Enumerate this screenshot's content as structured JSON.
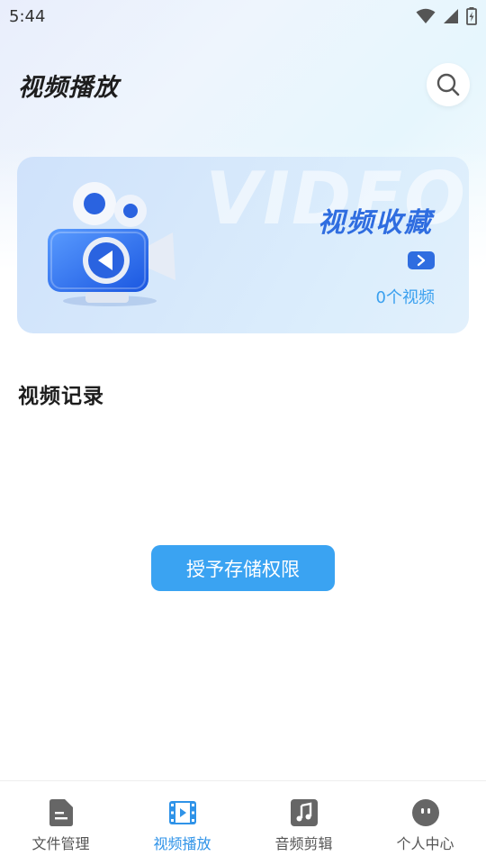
{
  "status_bar": {
    "time": "5:44"
  },
  "header": {
    "title": "视频播放"
  },
  "banner": {
    "watermark": "VIDEO",
    "title": "视频收藏",
    "count_text": "0个视频"
  },
  "section": {
    "title": "视频记录"
  },
  "permission_button": {
    "label": "授予存储权限"
  },
  "tabs": [
    {
      "label": "文件管理",
      "icon": "document-icon",
      "active": false
    },
    {
      "label": "视频播放",
      "icon": "film-icon",
      "active": true
    },
    {
      "label": "音频剪辑",
      "icon": "music-note-icon",
      "active": false
    },
    {
      "label": "个人中心",
      "icon": "face-icon",
      "active": false
    }
  ],
  "colors": {
    "accent": "#2f6de0",
    "button": "#3aa3f2",
    "tab_active": "#2f93e8",
    "tab_inactive": "#555555"
  }
}
